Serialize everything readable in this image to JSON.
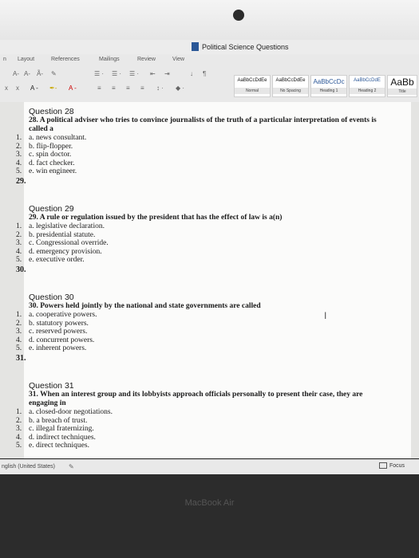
{
  "window": {
    "title": "Political Science Questions"
  },
  "ribbon": {
    "tabs": [
      {
        "label": "n"
      },
      {
        "label": "Layout"
      },
      {
        "label": "References"
      },
      {
        "label": "Mailings"
      },
      {
        "label": "Review"
      },
      {
        "label": "View"
      }
    ],
    "font_row_1": [
      "A-",
      "A-",
      "Ã-",
      "✎"
    ],
    "font_row_2": [
      "x",
      "x",
      "A -",
      "✒-",
      "A -"
    ],
    "para_icon": "¶",
    "styles": [
      {
        "sample": "AaBbCcDdEe",
        "name": "Normal"
      },
      {
        "sample": "AaBbCcDdEe",
        "name": "No Spacing"
      },
      {
        "sample": "AaBbCcDc",
        "name": "Heading 1"
      },
      {
        "sample": "AaBbCcDdE",
        "name": "Heading 2"
      },
      {
        "sample": "AaBb",
        "name": "Title"
      }
    ]
  },
  "questions": [
    {
      "heading": "Question 28",
      "text": "28. A political adviser who tries to convince journalists of the truth of a particular interpretation of events is called a",
      "options": [
        {
          "num": "1.",
          "text": "a. news consultant."
        },
        {
          "num": "2.",
          "text": "b. flip-flopper."
        },
        {
          "num": "3.",
          "text": "c. spin doctor."
        },
        {
          "num": "4.",
          "text": "d. fact checker."
        },
        {
          "num": "5.",
          "text": "e. win engineer."
        }
      ],
      "answer": "29."
    },
    {
      "heading": "Question 29",
      "text": "29. A rule or regulation issued by the president that has the effect of law is a(n)",
      "options": [
        {
          "num": "1.",
          "text": "a. legislative declaration."
        },
        {
          "num": "2.",
          "text": "b. presidential statute."
        },
        {
          "num": "3.",
          "text": "c. Congressional override."
        },
        {
          "num": "4.",
          "text": "d. emergency provision."
        },
        {
          "num": "5.",
          "text": "e. executive order."
        }
      ],
      "answer": "30."
    },
    {
      "heading": "Question 30",
      "text": "30. Powers held jointly by the national and state governments are called",
      "options": [
        {
          "num": "1.",
          "text": "a. cooperative powers."
        },
        {
          "num": "2.",
          "text": "b. statutory powers."
        },
        {
          "num": "3.",
          "text": "c. reserved powers."
        },
        {
          "num": "4.",
          "text": "d. concurrent powers."
        },
        {
          "num": "5.",
          "text": "e. inherent powers."
        }
      ],
      "answer": "31."
    },
    {
      "heading": "Question 31",
      "text": "31. When an interest group and its lobbyists approach officials personally to present their case, they are engaging in",
      "options": [
        {
          "num": "1.",
          "text": "a. closed-door negotiations."
        },
        {
          "num": "2.",
          "text": "b. a breach of trust."
        },
        {
          "num": "3.",
          "text": "c. illegal fraternizing."
        },
        {
          "num": "4.",
          "text": "d. indirect techniques."
        },
        {
          "num": "5.",
          "text": "e. direct techniques."
        }
      ]
    }
  ],
  "status": {
    "language": "nglish (United States)",
    "focus_label": "Focus"
  },
  "device": {
    "brand": "MacBook Air"
  },
  "colors": {
    "doc_icon": "#2b5797",
    "page_bg": "#fbfbfa",
    "ribbon_bg": "#e9e9e9"
  }
}
